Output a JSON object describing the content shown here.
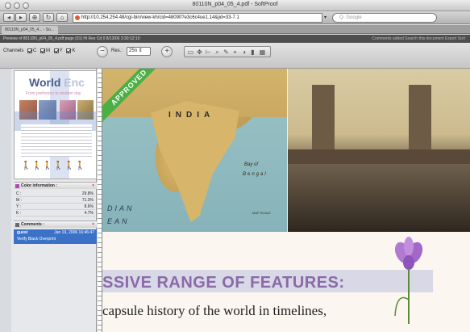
{
  "window": {
    "title": "80110N_p04_05_4.pdf - SoftProof"
  },
  "browser": {
    "url": "http://10.254.254.48/cgi-bin/view-kh/cid=48090?e3c6c4ue1.14&jid=33-7.1",
    "search_placeholder": "Q- Google",
    "tab_label": "80110N_p04_05_4... - So..."
  },
  "infobar": {
    "left_text": "Preview of 80110N_p04_05_4.pdf page (01) Hi Res Cd 0 8/13/06 3:30:12:10",
    "right_text": "Comments added  Search this document  Export  Sort"
  },
  "softproof_toolbar": {
    "channels_label": "Channels",
    "channels": [
      "C",
      "M",
      "Y",
      "K"
    ],
    "resolution_label": "Res.:",
    "resolution_value": "25n"
  },
  "left_panel": {
    "thumbnail": {
      "title_main": "World",
      "title_faded": " Enc",
      "subtitle": "From prehistory to modern day"
    },
    "color_info": {
      "header": "Color information :",
      "rows": [
        {
          "label": "C :",
          "value": "29.8%"
        },
        {
          "label": "M :",
          "value": "71.3%"
        },
        {
          "label": "Y :",
          "value": "8.6%"
        },
        {
          "label": "K :",
          "value": "4.7%"
        }
      ]
    },
    "comments": {
      "header": "Comments :",
      "items": [
        {
          "author": "guest",
          "date": "Jan 19, 2006 16:46:47",
          "text": "Verify Black Overprint"
        }
      ]
    }
  },
  "document": {
    "approved_stamp": "APPROVED",
    "map_labels": {
      "country": "INDIA",
      "sea": "DIAN",
      "sea2": "EAN",
      "bay_line1": "Bay of",
      "bay_line2": "Bengal",
      "scale": "MAP SCALE"
    },
    "headline": "SSIVE RANGE OF FEATURES:",
    "body_text": "capsule history of the world in timelines,"
  },
  "colors": {
    "approved_green": "#4bb043",
    "headline_purple": "#8a6aa8",
    "comment_blue": "#3b72c8"
  }
}
